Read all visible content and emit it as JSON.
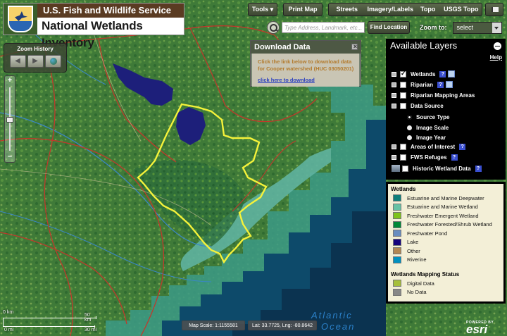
{
  "header": {
    "agency": "U.S. Fish and Wildlife Service",
    "program": "National Wetlands Inventory"
  },
  "toolbar": {
    "tools_label": "Tools",
    "print_label": "Print Map",
    "basemaps": [
      "Streets",
      "Imagery/Labels",
      "Topo",
      "USGS Topo"
    ]
  },
  "search": {
    "placeholder": "Type Address, Landmark, etc...",
    "find_label": "Find Location",
    "zoom_to_label": "Zoom to:",
    "zoom_to_value": "select"
  },
  "zoom_history": {
    "title": "Zoom History"
  },
  "download": {
    "title": "Download Data",
    "message": "Click the link below to download data for Cooper watershed (HUC 03050201)",
    "link": "click here to download"
  },
  "layers": {
    "title": "Available Layers",
    "help": "Help",
    "items": [
      {
        "label": "Wetlands",
        "checked": true
      },
      {
        "label": "Riparian",
        "checked": false
      },
      {
        "label": "Riparian Mapping Areas",
        "checked": false
      },
      {
        "label": "Data Source",
        "checked": false
      },
      {
        "label": "Source Type",
        "selected": true
      },
      {
        "label": "Image Scale",
        "selected": false
      },
      {
        "label": "Image Year",
        "selected": false
      },
      {
        "label": "Areas of Interest",
        "checked": false
      },
      {
        "label": "FWS Refuges",
        "checked": false
      },
      {
        "label": "Historic Wetland Data",
        "checked": false
      }
    ]
  },
  "legend": {
    "wetlands_title": "Wetlands",
    "wetlands": [
      {
        "label": "Estuarine and Marine Deepwater",
        "color": "#0f7f7a"
      },
      {
        "label": "Estuarine and Marine Wetland",
        "color": "#66c2a5"
      },
      {
        "label": "Freshwater Emergent Wetland",
        "color": "#7fc31c"
      },
      {
        "label": "Freshwater Forested/Shrub Wetland",
        "color": "#008837"
      },
      {
        "label": "Freshwater Pond",
        "color": "#688cc0"
      },
      {
        "label": "Lake",
        "color": "#13007c"
      },
      {
        "label": "Other",
        "color": "#b28653"
      },
      {
        "label": "Riverine",
        "color": "#0190bf"
      }
    ],
    "status_title": "Wetlands Mapping Status",
    "status": [
      {
        "label": "Digital Data",
        "color": "#a6bf3a"
      },
      {
        "label": "No Data",
        "color": "#888888"
      }
    ]
  },
  "map": {
    "ocean_label_1": "Atlantic",
    "ocean_label_2": "Ocean",
    "scale_text": "Map Scale: 1:1155581",
    "coords_text": "Lat: 33.7725, Lng: -80.8642",
    "scale_km_a": "0 km",
    "scale_km_b": "50 km",
    "scale_mi_a": "0 mi",
    "scale_mi_b": "30 mi",
    "powered_by": "POWERED BY",
    "esri": "esri"
  }
}
